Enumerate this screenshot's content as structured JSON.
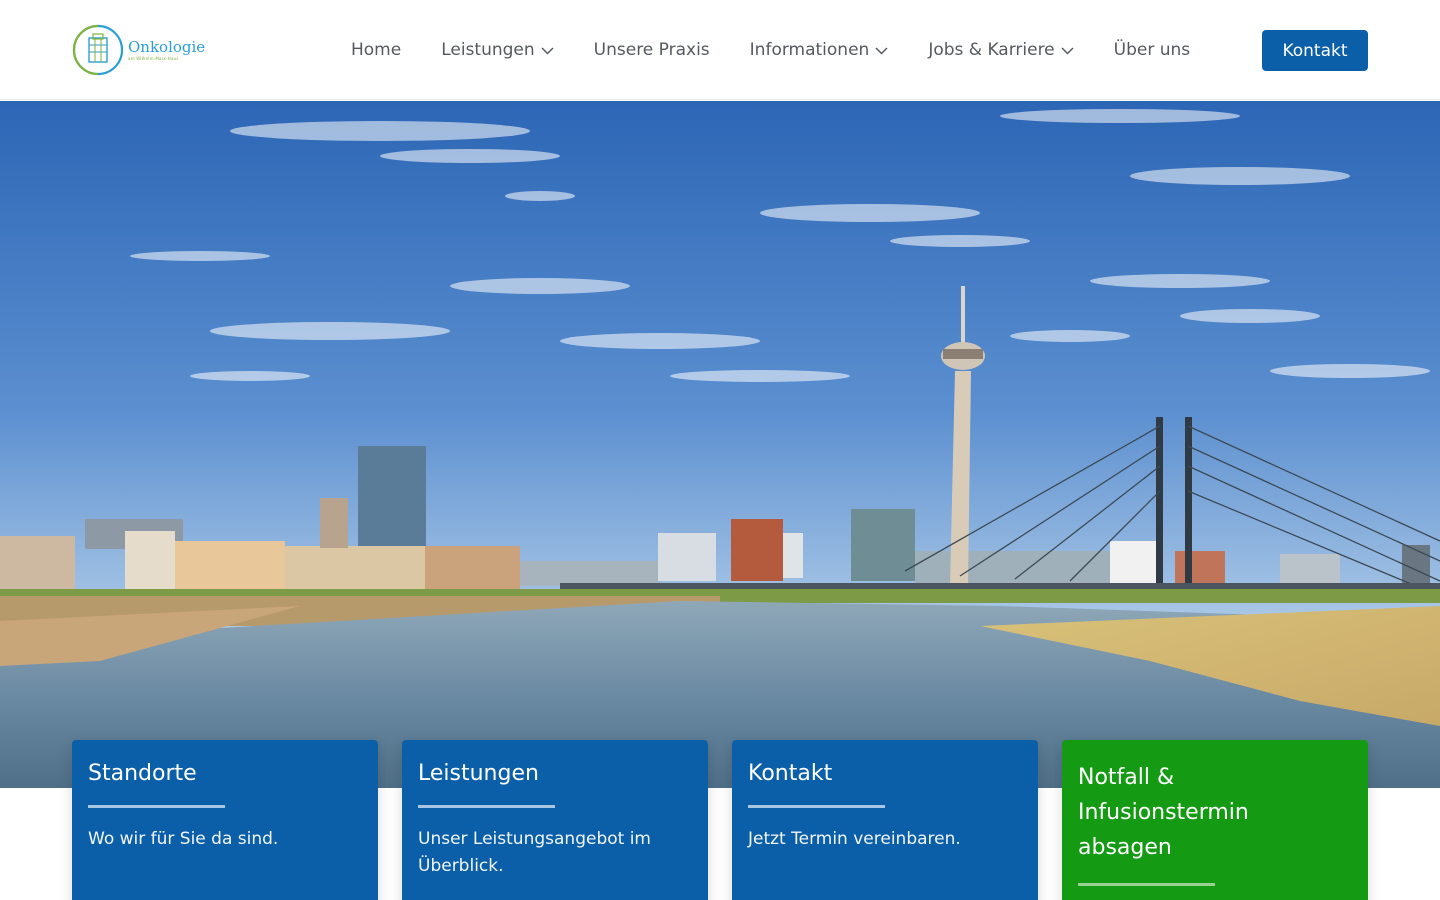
{
  "brand": {
    "name": "Onkologie",
    "tagline": "am Wilhelm-Marx-Haus",
    "colors": {
      "primary": "#0a5fa8",
      "green": "#159a14",
      "logo_blue": "#2a9fd6",
      "logo_green": "#7fb33a"
    }
  },
  "nav": {
    "items": [
      {
        "label": "Home",
        "dropdown": false
      },
      {
        "label": "Leistungen",
        "dropdown": true
      },
      {
        "label": "Unsere Praxis",
        "dropdown": false
      },
      {
        "label": "Informationen",
        "dropdown": true
      },
      {
        "label": "Jobs & Karriere",
        "dropdown": true
      },
      {
        "label": "Über uns",
        "dropdown": false
      }
    ],
    "cta": "Kontakt"
  },
  "cards": [
    {
      "title": "Standorte",
      "text": "Wo wir für Sie da sind.",
      "color": "#0a5fa8"
    },
    {
      "title": "Leistungen",
      "text": "Unser Leistungsangebot im Überblick.",
      "color": "#0a5fa8"
    },
    {
      "title": "Kontakt",
      "text": "Jetzt Termin vereinbaren.",
      "color": "#0a5fa8"
    },
    {
      "title": "Notfall & Infusionstermin absagen",
      "text": "",
      "color": "#159a14"
    }
  ]
}
